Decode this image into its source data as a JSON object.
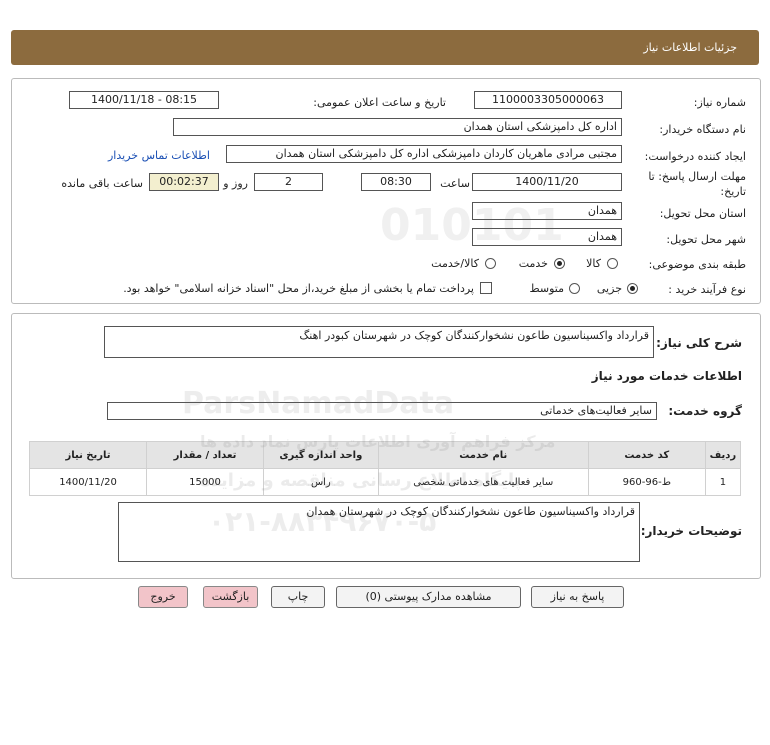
{
  "header": {
    "title": "جزئیات اطلاعات نیاز"
  },
  "details": {
    "need_number_label": "شماره نیاز:",
    "need_number": "1100003305000063",
    "announce_label": "تاریخ و ساعت اعلان عمومی:",
    "announce_value": "1400/11/18 - 08:15",
    "buyer_org_label": "نام دستگاه خریدار:",
    "buyer_org": "اداره کل دامپزشکی استان همدان",
    "creator_label": "ایجاد کننده درخواست:",
    "creator": "مجتبی مرادی ماهریان کاردان دامپزشکی اداره کل دامپزشکی استان همدان",
    "contact_link": "اطلاعات تماس خریدار",
    "deadline_label": "مهلت ارسال پاسخ: تا",
    "deadline_label2": "تاریخ:",
    "deadline_date": "1400/11/20",
    "time_label": "ساعت",
    "deadline_time": "08:30",
    "days_value": "2",
    "days_label": "روز و",
    "remaining_time": "00:02:37",
    "remaining_label": "ساعت باقی مانده",
    "delivery_province_label": "استان محل تحویل:",
    "delivery_province": "همدان",
    "delivery_city_label": "شهر محل تحویل:",
    "delivery_city": "همدان",
    "category_label": "طبقه بندی موضوعی:",
    "category_options": [
      "کالا",
      "خدمت",
      "کالا/خدمت"
    ],
    "process_label": "نوع فرآیند خرید :",
    "process_options": [
      "جزیی",
      "متوسط"
    ],
    "payment_note": "پرداخت تمام یا بخشی از مبلغ خرید،از محل \"اسناد خزانه اسلامی\" خواهد بود."
  },
  "summary": {
    "label": "شرح کلی نیاز:",
    "value": "قرارداد واکسیناسیون طاعون نشخوارکنندگان کوچک در شهرستان کبودر اهنگ",
    "services_title": "اطلاعات خدمات مورد نیاز",
    "service_group_label": "گروه خدمت:",
    "service_group": "سایر فعالیت‌های خدماتی"
  },
  "table": {
    "headers": [
      "ردیف",
      "کد خدمت",
      "نام خدمت",
      "واحد اندازه گیری",
      "تعداد / مقدار",
      "تاریخ نیاز"
    ],
    "rows": [
      [
        "1",
        "ط-96-960",
        "سایر فعالیت های خدماتی شخصی",
        "راس",
        "15000",
        "1400/11/20"
      ]
    ]
  },
  "buyer_notes": {
    "label": "توضیحات خریدار:",
    "value": "قرارداد واکسیناسیون طاعون نشخوارکنندگان کوچک در شهرستان همدان"
  },
  "buttons": {
    "reply": "پاسخ به نیاز",
    "attachments": "مشاهده مدارک پیوستی (0)",
    "print": "چاپ",
    "back": "بازگشت",
    "exit": "خروج"
  },
  "watermark": {
    "digits": "010101",
    "brand": "ParsNamadData",
    "tagline1": "مرکز فراهم آوری اطلاعات پارس نماد داده ها",
    "tagline2": "پایگاه اطلاع رسانی مناقصه و مزایده",
    "phone": "۰۲۱-۸۸۳۴۹۶۷۰-۵"
  },
  "colors": {
    "header_bg": "#8c6b3e",
    "pink_button": "#f2c4c9",
    "link": "#1a4fb4"
  }
}
